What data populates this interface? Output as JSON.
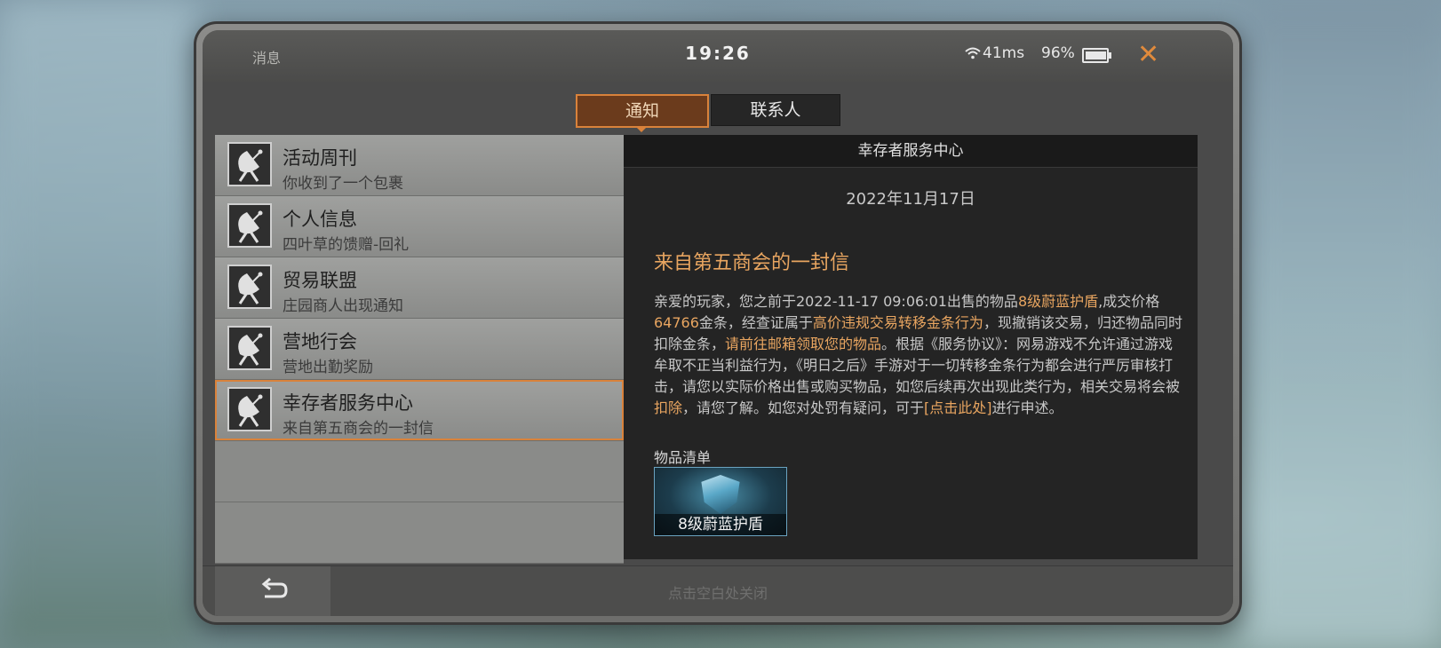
{
  "topbar": {
    "title": "消息",
    "clock": "19:26",
    "ping": "41ms",
    "battery": "96%"
  },
  "tabs": [
    {
      "label": "通知",
      "active": true
    },
    {
      "label": "联系人",
      "active": false
    }
  ],
  "messages": [
    {
      "title": "活动周刊",
      "subtitle": "你收到了一个包裹",
      "icon": "satellite-dish-icon"
    },
    {
      "title": "个人信息",
      "subtitle": "四叶草的馈赠-回礼",
      "icon": "satellite-dish-icon"
    },
    {
      "title": "贸易联盟",
      "subtitle": "庄园商人出现通知",
      "icon": "satellite-dish-icon"
    },
    {
      "title": "营地行会",
      "subtitle": "营地出勤奖励",
      "icon": "satellite-dish-icon"
    },
    {
      "title": "幸存者服务中心",
      "subtitle": "来自第五商会的一封信",
      "icon": "satellite-dish-icon",
      "selected": true
    }
  ],
  "detail": {
    "sender": "幸存者服务中心",
    "date": "2022年11月17日",
    "title": "来自第五商会的一封信",
    "body": {
      "p1": "亲爱的玩家，您之前于2022-11-17 09:06:01出售的物品",
      "h1": "8级蔚蓝护盾",
      "p2": ",成交价格",
      "h2": "64766",
      "p3": "金条，经查证属于",
      "h3": "高价违规交易转移金条行为",
      "p4": "，现撤销该交易，归还物品同时扣除金条，",
      "h4": "请前往邮箱领取您的物品",
      "p5": "。根据《服务协议》：网易游戏不允许通过游戏牟取不正当利益行为，《明日之后》手游对于一切转移金条行为都会进行严厉审核打击，请您以实际价格出售或购买物品，如您后续再次出现此类行为，相关交易将会被",
      "h5": "扣除",
      "p6": "，请您了解。如您对处罚有疑问，可于",
      "link": "[点击此处]",
      "p7": "进行申述。"
    },
    "items_label": "物品清单",
    "items": [
      {
        "name": "8级蔚蓝护盾"
      }
    ]
  },
  "bottom": {
    "close_hint": "点击空白处关闭"
  },
  "colors": {
    "accent": "#d9823b",
    "highlight": "#e8a560"
  }
}
